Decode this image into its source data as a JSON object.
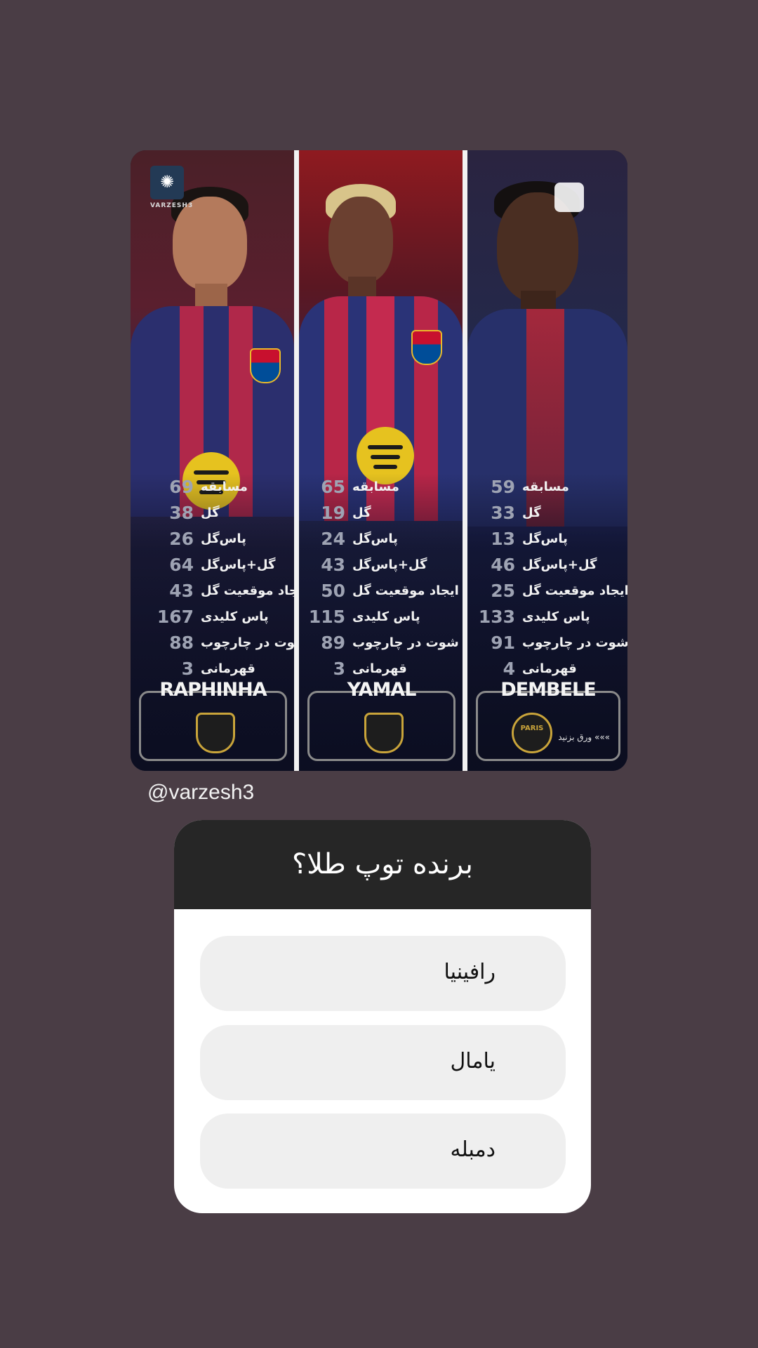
{
  "post": {
    "brand_text": "VARZESH3",
    "brand_icon": "varzesh3-logo-icon",
    "swipe_text": "ورق بزنید «««",
    "players": [
      {
        "name": "RAPHINHA",
        "club": "FC Barcelona",
        "stats": [
          {
            "value": "69",
            "label": "مسابقه"
          },
          {
            "value": "38",
            "label": "گل"
          },
          {
            "value": "26",
            "label": "پاس‌گل"
          },
          {
            "value": "64",
            "label": "گل+پاس‌گل"
          },
          {
            "value": "43",
            "label": "ایجاد موقعیت گل"
          },
          {
            "value": "167",
            "label": "پاس کلیدی"
          },
          {
            "value": "88",
            "label": "شوت در چارچوب"
          },
          {
            "value": "3",
            "label": "قهرمانی"
          }
        ]
      },
      {
        "name": "YAMAL",
        "club": "FC Barcelona",
        "stats": [
          {
            "value": "65",
            "label": "مسابقه"
          },
          {
            "value": "19",
            "label": "گل"
          },
          {
            "value": "24",
            "label": "پاس‌گل"
          },
          {
            "value": "43",
            "label": "گل+پاس‌گل"
          },
          {
            "value": "50",
            "label": "ایجاد موقعیت گل"
          },
          {
            "value": "115",
            "label": "پاس کلیدی"
          },
          {
            "value": "89",
            "label": "شوت در چارچوب"
          },
          {
            "value": "3",
            "label": "قهرمانی"
          }
        ]
      },
      {
        "name": "DEMBELE",
        "club": "PARIS",
        "stats": [
          {
            "value": "59",
            "label": "مسابقه"
          },
          {
            "value": "33",
            "label": "گل"
          },
          {
            "value": "13",
            "label": "پاس‌گل"
          },
          {
            "value": "46",
            "label": "گل+پاس‌گل"
          },
          {
            "value": "25",
            "label": "ایجاد موقعیت گل"
          },
          {
            "value": "133",
            "label": "پاس کلیدی"
          },
          {
            "value": "91",
            "label": "شوت در چارچوب"
          },
          {
            "value": "4",
            "label": "قهرمانی"
          }
        ]
      }
    ]
  },
  "mention": "@varzesh3",
  "poll": {
    "question": "برنده توپ طلا؟",
    "options": [
      "رافینیا",
      "یامال",
      "دمبله"
    ]
  },
  "colors": {
    "background": "#4a3d45",
    "poll_header": "#262626",
    "option_bg": "#efefef"
  }
}
